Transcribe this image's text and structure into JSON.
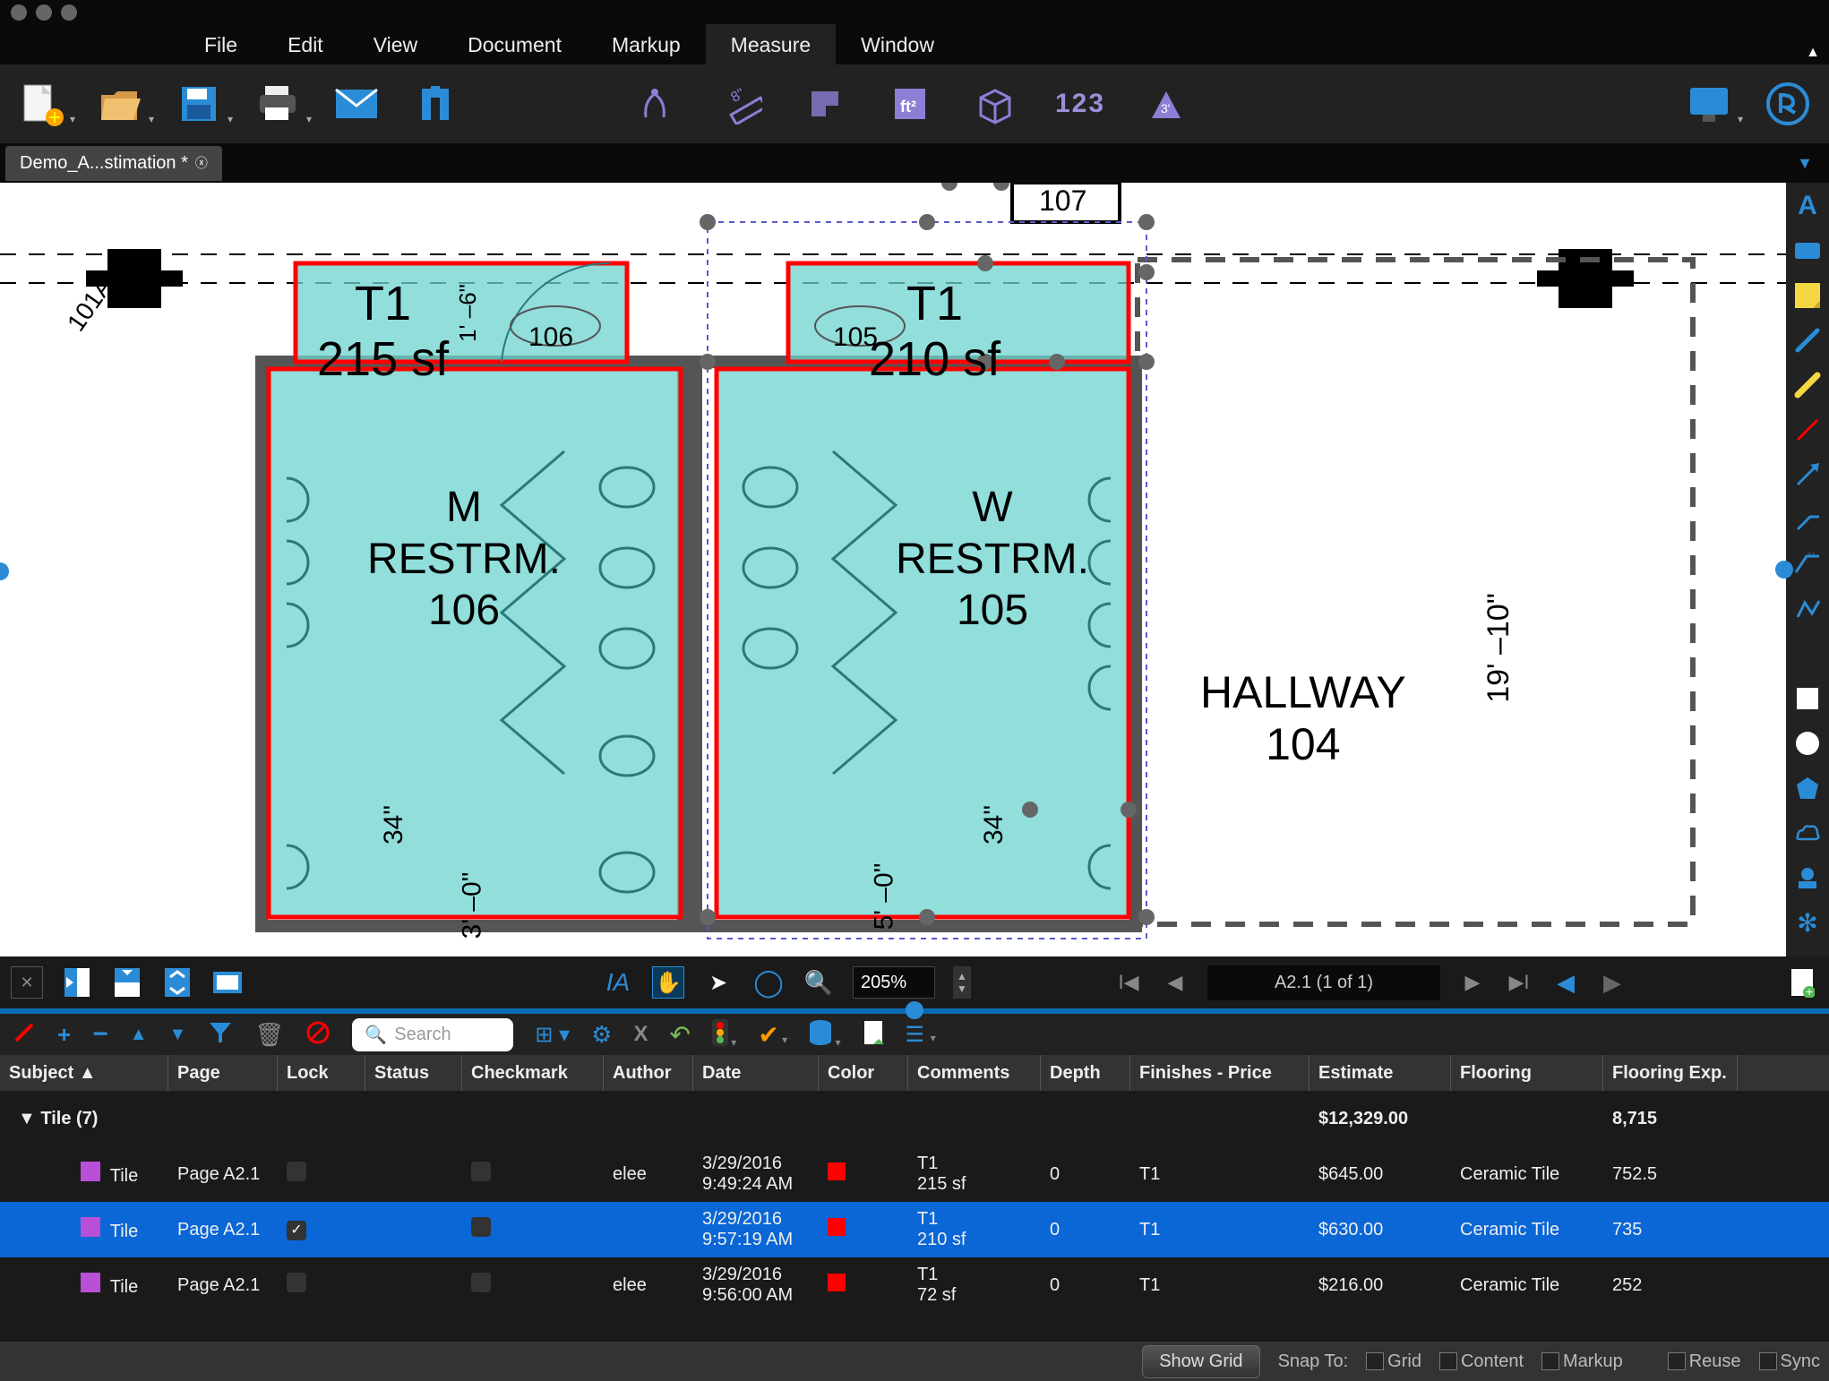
{
  "menu": [
    "File",
    "Edit",
    "View",
    "Document",
    "Markup",
    "Measure",
    "Window"
  ],
  "menu_active": 5,
  "tab": {
    "label": "Demo_A...stimation *"
  },
  "floorplan": {
    "room_101a": "101A",
    "room_106_title": "T1\n215 sf",
    "room_106_label": "M\nRESTRM.\n106",
    "room_106_door": "106",
    "room_105_title": "T1\n210 sf",
    "room_105_label": "W\nRESTRM.\n105",
    "room_105_door": "105",
    "room_107": "107",
    "hallway": "HALLWAY\n104",
    "dim_1910": "19' –10\"",
    "dim_34a": "34\"",
    "dim_34b": "34\"",
    "dim_30": "3' –0\"",
    "dim_50": "5' –0\"",
    "dim_16": "1' –6\""
  },
  "view": {
    "zoom": "205%",
    "page": "A2.1 (1 of 1)"
  },
  "search_placeholder": "Search",
  "measure_count": "123",
  "columns": [
    "Subject",
    "Page",
    "Lock",
    "Status",
    "Checkmark",
    "Author",
    "Date",
    "Color",
    "Comments",
    "Depth",
    "Finishes - Price",
    "Estimate",
    "Flooring",
    "Flooring Exp."
  ],
  "summary": {
    "label": "Tile (7)",
    "estimate": "$12,329.00",
    "flooring_exp": "8,715"
  },
  "rows": [
    {
      "subject": "Tile",
      "page": "Page A2.1",
      "lock": false,
      "author": "elee",
      "date": "3/29/2016\n9:49:24 AM",
      "comments": "T1\n215 sf",
      "depth": "0",
      "finishes": "T1",
      "estimate": "$645.00",
      "flooring": "Ceramic Tile",
      "fexp": "752.5",
      "selected": false
    },
    {
      "subject": "Tile",
      "page": "Page A2.1",
      "lock": true,
      "author": "",
      "date": "3/29/2016\n9:57:19 AM",
      "comments": "T1\n210 sf",
      "depth": "0",
      "finishes": "T1",
      "estimate": "$630.00",
      "flooring": "Ceramic Tile",
      "fexp": "735",
      "selected": true
    },
    {
      "subject": "Tile",
      "page": "Page A2.1",
      "lock": false,
      "author": "elee",
      "date": "3/29/2016\n9:56:00 AM",
      "comments": "T1\n72 sf",
      "depth": "0",
      "finishes": "T1",
      "estimate": "$216.00",
      "flooring": "Ceramic Tile",
      "fexp": "252",
      "selected": false
    }
  ],
  "footer": {
    "showgrid": "Show Grid",
    "snapto": "Snap To:",
    "grid": "Grid",
    "content": "Content",
    "markup": "Markup",
    "reuse": "Reuse",
    "sync": "Sync"
  }
}
